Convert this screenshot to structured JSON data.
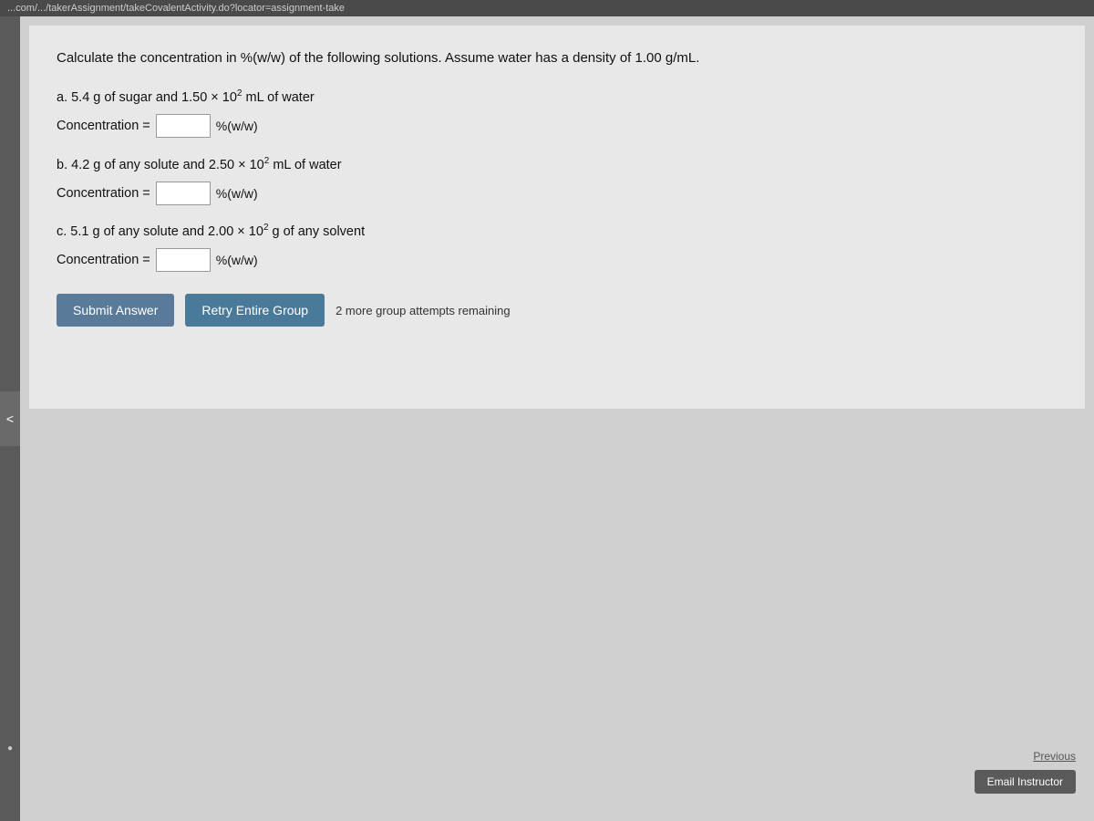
{
  "topbar": {
    "url": "...com/.../takerAssignment/takeCovalentActivity.do?locator=assignment-take"
  },
  "sidebar": {
    "arrow_label": "<"
  },
  "question": {
    "title": "Calculate the concentration in %(w/w) of the following solutions. Assume water has a density of 1.00 g/mL.",
    "sub_questions": [
      {
        "id": "a",
        "text_before": "a. 5.4 g of sugar and 1.50 × 10",
        "superscript": "2",
        "text_after": " mL of water",
        "concentration_label": "Concentration =",
        "unit": "%(w/w)",
        "input_value": ""
      },
      {
        "id": "b",
        "text_before": "b. 4.2 g of any solute and 2.50 × 10",
        "superscript": "2",
        "text_after": " mL of water",
        "concentration_label": "Concentration =",
        "unit": "%(w/w)",
        "input_value": ""
      },
      {
        "id": "c",
        "text_before": "c. 5.1 g of any solute and 2.00 × 10",
        "superscript": "2",
        "text_after": " g of any solvent",
        "concentration_label": "Concentration =",
        "unit": "%(w/w)",
        "input_value": ""
      }
    ],
    "buttons": {
      "submit_label": "Submit Answer",
      "retry_label": "Retry Entire Group",
      "attempts_text": "2 more group attempts remaining"
    }
  },
  "bottom": {
    "previous_label": "Previous",
    "email_instructor_label": "Email Instructor"
  }
}
